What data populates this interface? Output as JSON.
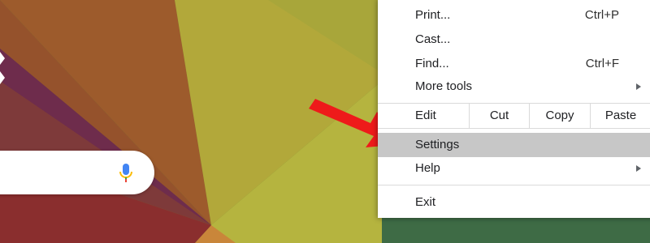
{
  "menu": {
    "items_top": [
      {
        "label": "Print...",
        "shortcut": "Ctrl+P"
      },
      {
        "label": "Cast...",
        "shortcut": ""
      },
      {
        "label": "Find...",
        "shortcut": "Ctrl+F"
      },
      {
        "label": "More tools",
        "shortcut": ""
      }
    ],
    "edit": {
      "label": "Edit",
      "cut": "Cut",
      "copy": "Copy",
      "paste": "Paste"
    },
    "settings": "Settings",
    "help": "Help",
    "exit": "Exit"
  },
  "colors": {
    "highlight": "#c7c7c7",
    "arrow": "#ee1a1a"
  },
  "icons": [
    "microphone-icon",
    "submenu-arrow-icon"
  ]
}
